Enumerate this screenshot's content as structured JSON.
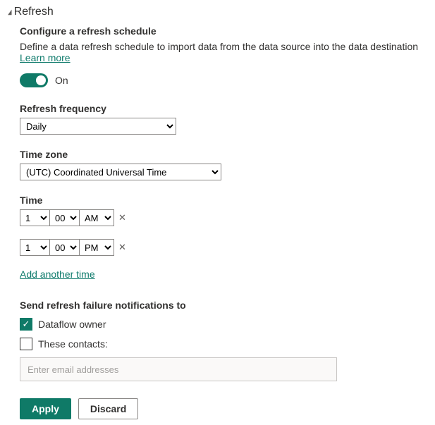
{
  "section": {
    "title": "Refresh"
  },
  "configure": {
    "heading": "Configure a refresh schedule",
    "description": "Define a data refresh schedule to import data from the data source into the data destination",
    "learn_more": "Learn more"
  },
  "toggle": {
    "label": "On",
    "on": true
  },
  "frequency": {
    "label": "Refresh frequency",
    "value": "Daily"
  },
  "timezone": {
    "label": "Time zone",
    "value": "(UTC) Coordinated Universal Time"
  },
  "time": {
    "label": "Time",
    "entries": [
      {
        "hour": "1",
        "minute": "00",
        "ampm": "AM"
      },
      {
        "hour": "1",
        "minute": "00",
        "ampm": "PM"
      }
    ],
    "add_label": "Add another time"
  },
  "notifications": {
    "heading": "Send refresh failure notifications to",
    "owner_label": "Dataflow owner",
    "owner_checked": true,
    "contacts_label": "These contacts:",
    "contacts_checked": false,
    "placeholder": "Enter email addresses"
  },
  "buttons": {
    "apply": "Apply",
    "discard": "Discard"
  }
}
